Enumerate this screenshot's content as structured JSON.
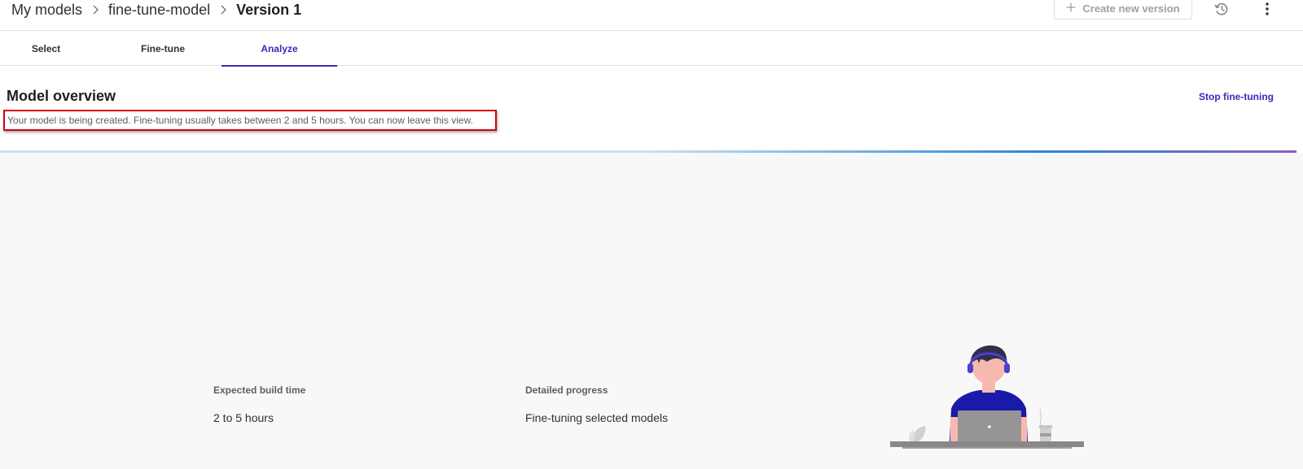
{
  "header": {
    "breadcrumb": [
      {
        "label": "My models"
      },
      {
        "label": "fine-tune-model"
      },
      {
        "label": "Version 1"
      }
    ],
    "create_version_label": "Create new version",
    "icons": {
      "separator": "chevron-right-icon",
      "create": "plus-icon",
      "history": "history-icon",
      "more": "more-vertical-icon"
    }
  },
  "tabs": [
    {
      "label": "Select",
      "active": false
    },
    {
      "label": "Fine-tune",
      "active": false
    },
    {
      "label": "Analyze",
      "active": true
    }
  ],
  "overview": {
    "title": "Model overview",
    "status_message": "Your model is being created. Fine-tuning usually takes between 2 and 5 hours. You can now leave this view.",
    "stop_label": "Stop fine-tuning"
  },
  "details": {
    "build_time_label": "Expected build time",
    "build_time_value": "2 to 5 hours",
    "progress_label": "Detailed progress",
    "progress_value": "Fine-tuning selected models"
  },
  "colors": {
    "accent": "#3b2ab8",
    "highlight_border": "#d9000d",
    "progress_start": "#c7e0f4",
    "progress_mid": "#2b88d8",
    "progress_end": "#8661c5"
  }
}
